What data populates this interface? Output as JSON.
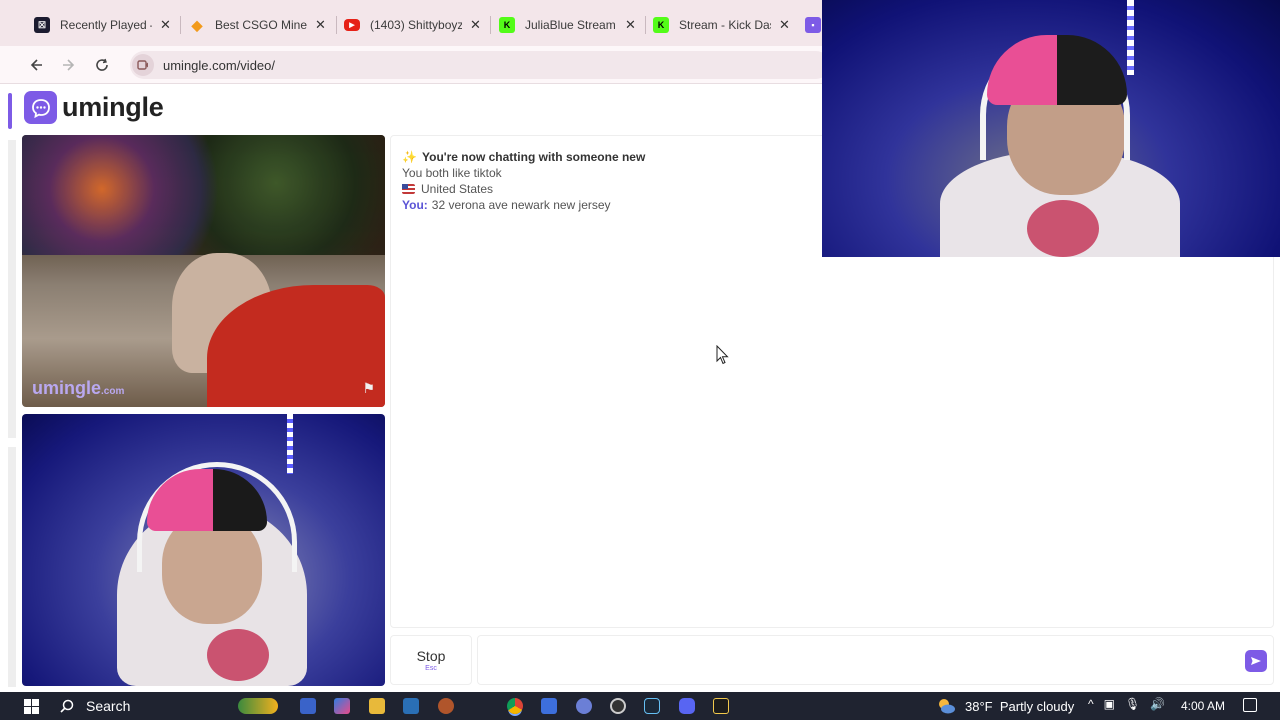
{
  "browser": {
    "tabs": [
      {
        "title": "Recently Played –",
        "favicon": "steam-style-icon",
        "color": "#1b1b2f"
      },
      {
        "title": "Best CSGO Mines",
        "favicon": "diamond-icon",
        "color": "#f29a1b"
      },
      {
        "title": "(1403) Shittyboyz",
        "favicon": "youtube-icon",
        "color": "#e62117"
      },
      {
        "title": "JuliaBlue Stream",
        "favicon": "kick-icon",
        "color": "#53fc18"
      },
      {
        "title": "Stream - Kick Das",
        "favicon": "kick-icon",
        "color": "#53fc18"
      }
    ],
    "url": "umingle.com/video/"
  },
  "site": {
    "brand": "umingle",
    "watermark": "umingle",
    "watermark_suffix": ".com",
    "accent_color": "#7d5be6"
  },
  "chat": {
    "header": "You're now chatting with someone new",
    "common_interest": "You both like tiktok",
    "location": "United States",
    "message_author": "You:",
    "message_text": "32 verona ave newark new jersey"
  },
  "controls": {
    "stop_label": "Stop",
    "stop_shortcut": "Esc",
    "message_placeholder": ""
  },
  "taskbar": {
    "search_label": "Search",
    "weather_temp": "38°F",
    "weather_desc": "Partly cloudy",
    "time": "4:00 AM"
  }
}
